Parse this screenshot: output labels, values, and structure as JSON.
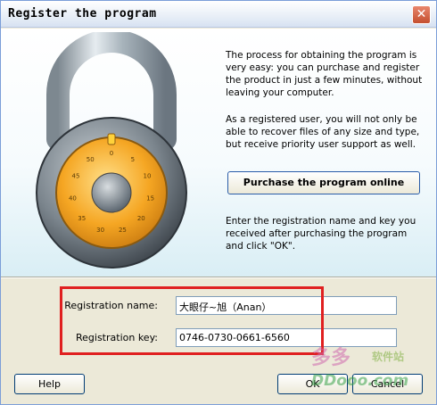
{
  "window": {
    "title": "Register the program",
    "close_glyph": "✕"
  },
  "info": {
    "para1": "The process for obtaining the program is very easy: you can purchase and register the product in just a few minutes, without leaving your computer.",
    "para2": "As a registered user, you will not only be able to recover files of any size and type, but receive priority user support as well.",
    "purchase_button": "Purchase the program online",
    "para3": "Enter the registration name and key you received after purchasing the program and click \"OK\"."
  },
  "lock_dial": {
    "numbers": [
      "0",
      "5",
      "10",
      "15",
      "20",
      "25",
      "30",
      "35",
      "40",
      "45",
      "50"
    ]
  },
  "form": {
    "name_label": "Registration name:",
    "name_value": "大眼仔~旭（Anan）",
    "key_label": "Registration key:",
    "key_value": "0746-0730-0661-6560"
  },
  "buttons": {
    "help": "Help",
    "ok": "OK",
    "cancel": "Cancel"
  },
  "watermark": {
    "cn": "多多",
    "sub": "软件站",
    "url": "DDooo.com"
  },
  "colors": {
    "highlight": "#e02020",
    "dial": "#f5a623",
    "titlebar": "#e8eef7"
  },
  "icons": [
    "padlock-icon",
    "close-icon"
  ]
}
